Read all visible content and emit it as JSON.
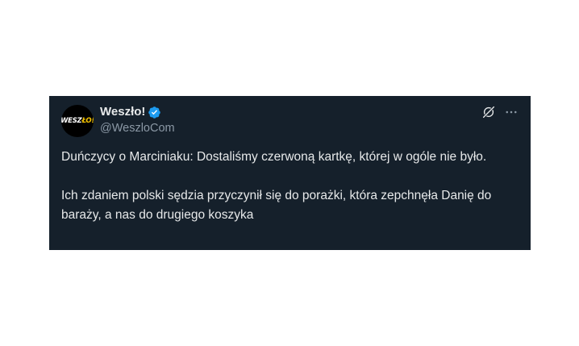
{
  "tweet": {
    "avatar_label": "WESZŁO!",
    "avatar_label_main": "WESZ",
    "avatar_label_accent": "ŁO!",
    "display_name": "Weszło!",
    "handle": "@WeszloCom",
    "verified": true,
    "paragraphs": [
      "Duńczycy o Marciniaku: Dostaliśmy czerwoną kartkę, której w ogóle nie było.",
      "Ich zdaniem polski sędzia przyczynił się do porażki, która zepchnęła Danię do baraży, a nas do drugiego koszyka"
    ]
  },
  "icons": {
    "verified": "verified-badge-icon",
    "grok": "grok-icon",
    "more": "more-icon"
  },
  "colors": {
    "card_background": "#15202b",
    "primary_text": "#e7e9ea",
    "secondary_text": "#8b98a5",
    "verified_blue": "#1d9bf0",
    "avatar_accent": "#f5c400"
  }
}
